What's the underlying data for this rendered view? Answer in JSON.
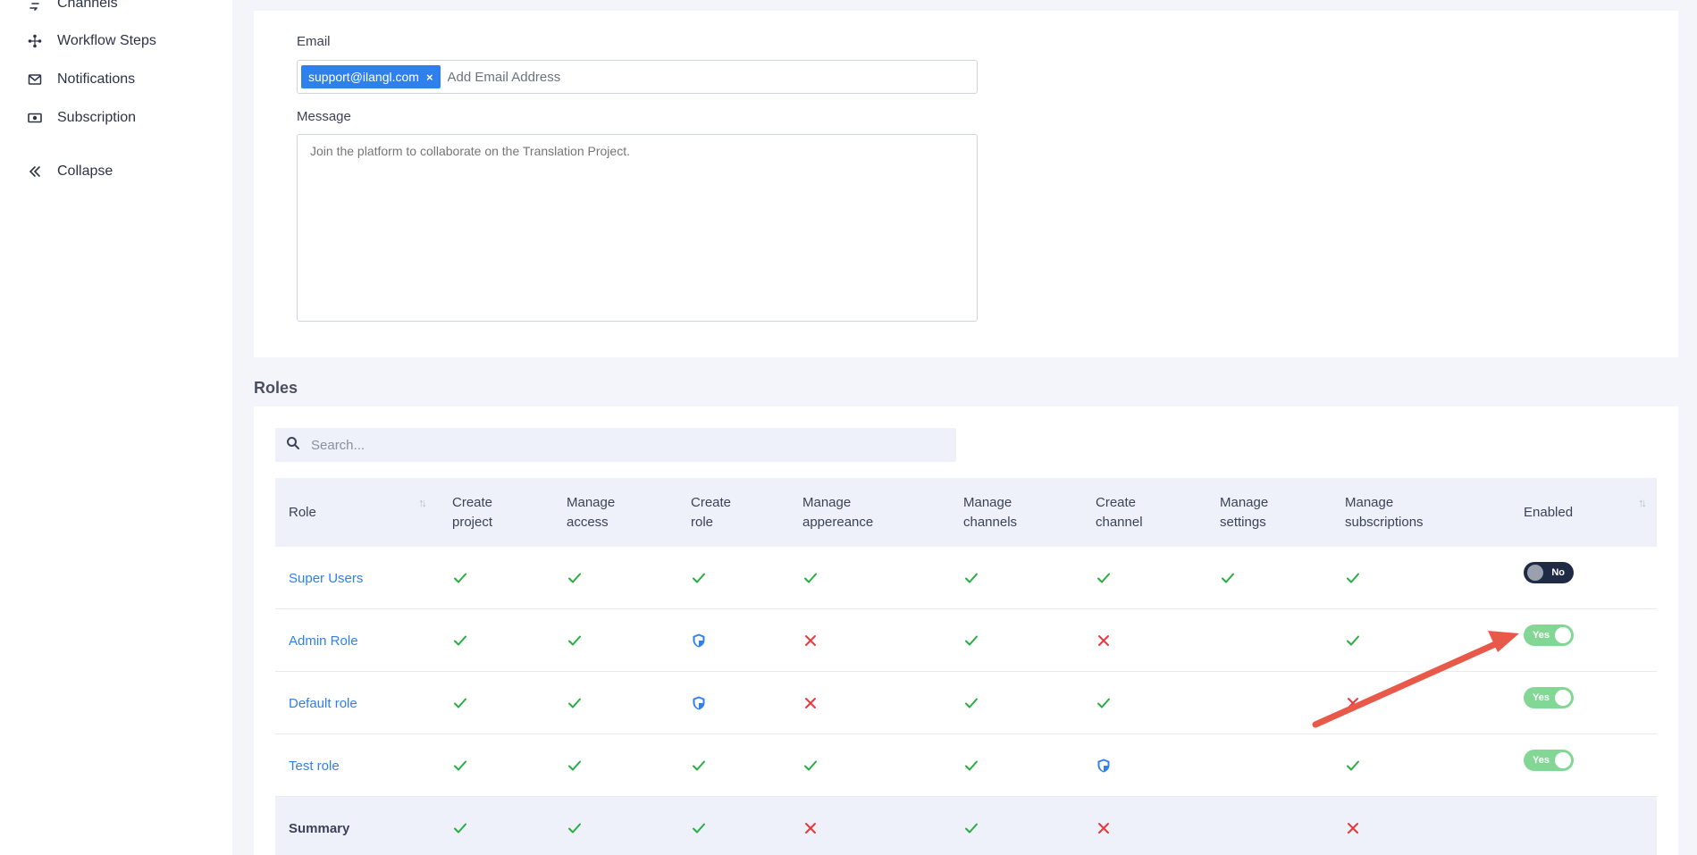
{
  "sidebar": {
    "items": [
      {
        "label": "Channels",
        "icon": "channels-icon"
      },
      {
        "label": "Workflow Steps",
        "icon": "workflow-icon"
      },
      {
        "label": "Notifications",
        "icon": "mail-icon"
      },
      {
        "label": "Subscription",
        "icon": "subscription-icon"
      },
      {
        "label": "Collapse",
        "icon": "double-chevron-left-icon"
      }
    ]
  },
  "invite": {
    "email_label": "Email",
    "email_chip": "support@ilangl.com",
    "email_chip_remove": "×",
    "email_placeholder": "Add Email Address",
    "message_label": "Message",
    "message_placeholder": "Join the platform to collaborate on the Translation Project."
  },
  "roles": {
    "title": "Roles",
    "search_placeholder": "Search...",
    "columns": {
      "role": "Role",
      "create_project": [
        "Create",
        "project"
      ],
      "manage_access": [
        "Manage",
        "access"
      ],
      "create_role": [
        "Create",
        "role"
      ],
      "manage_appereance": [
        "Manage",
        "appereance"
      ],
      "manage_channels": [
        "Manage",
        "channels"
      ],
      "create_channel": [
        "Create",
        "channel"
      ],
      "manage_settings": [
        "Manage",
        "settings"
      ],
      "manage_subscriptions": [
        "Manage",
        "subscriptions"
      ],
      "enabled": "Enabled"
    },
    "rows": [
      {
        "name": "Super Users",
        "perms": [
          "check",
          "check",
          "check",
          "check",
          "check",
          "check",
          "check",
          "check"
        ],
        "enabled": "No"
      },
      {
        "name": "Admin Role",
        "perms": [
          "check",
          "check",
          "shield",
          "cross",
          "check",
          "cross",
          "",
          "check"
        ],
        "enabled": "Yes"
      },
      {
        "name": "Default role",
        "perms": [
          "check",
          "check",
          "shield",
          "cross",
          "check",
          "check",
          "",
          "cross"
        ],
        "enabled": "Yes"
      },
      {
        "name": "Test role",
        "perms": [
          "check",
          "check",
          "check",
          "check",
          "check",
          "shield",
          "",
          "check"
        ],
        "enabled": "Yes"
      }
    ],
    "summary": {
      "name": "Summary",
      "perms": [
        "check",
        "check",
        "check",
        "cross",
        "check",
        "cross",
        "",
        "cross"
      ]
    },
    "colors": {
      "check": "#27ae43",
      "cross": "#e5393f",
      "shield": "#2f80ed",
      "toggle_on": "#1fb83d",
      "toggle_off": "#1f2a44",
      "arrow": "#e8594a"
    }
  }
}
